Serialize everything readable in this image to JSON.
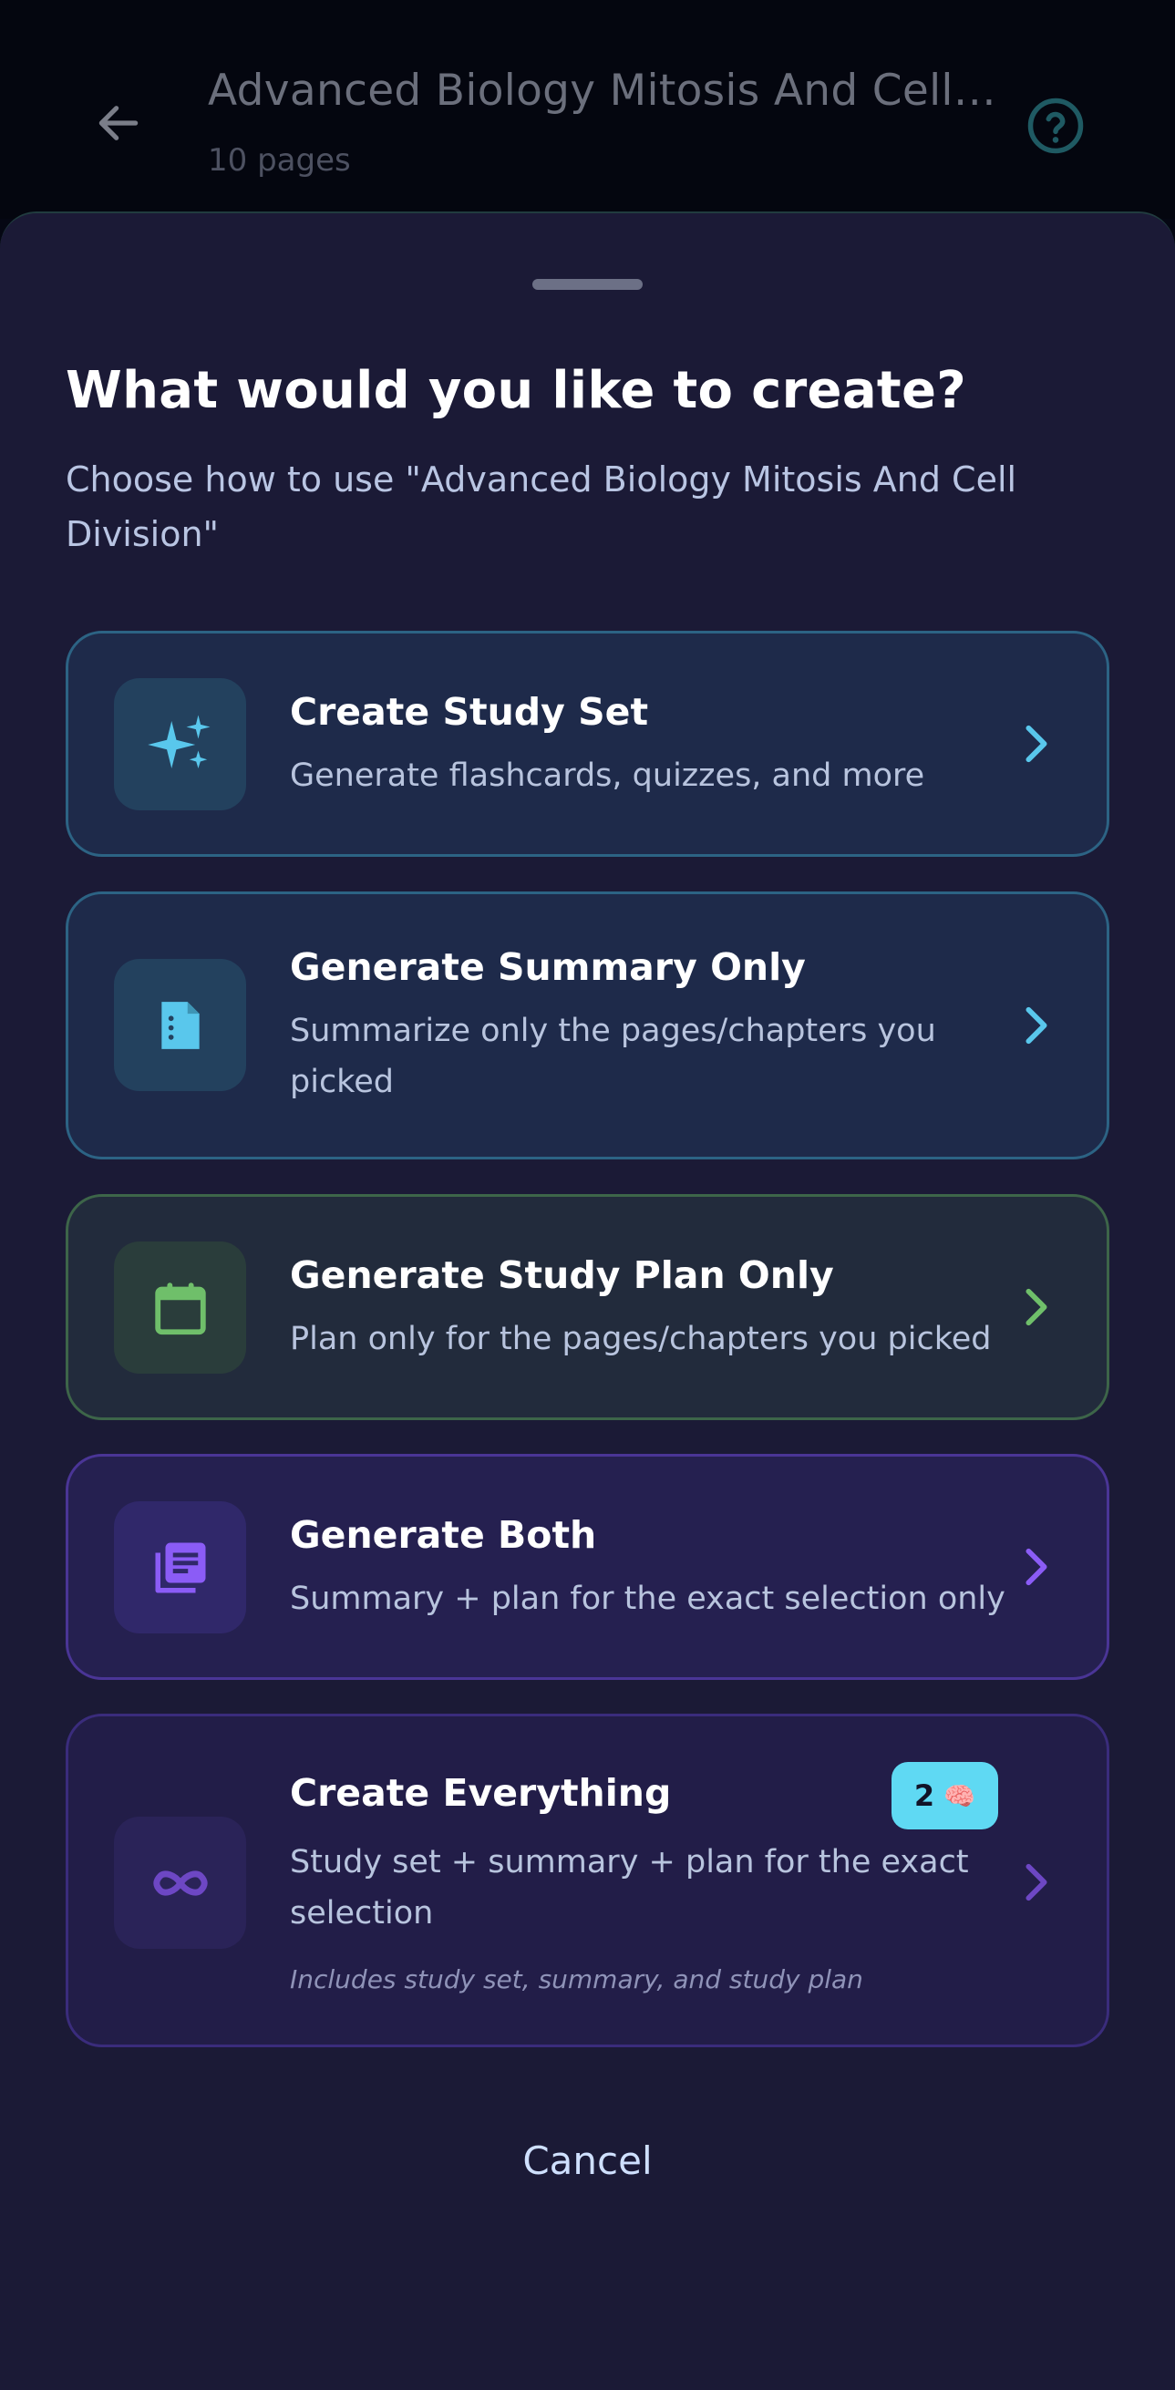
{
  "header": {
    "title": "Advanced Biology Mitosis And Cell Division",
    "subtitle": "10 pages",
    "back_icon": "arrow-left-icon",
    "help_icon": "question-circle-icon"
  },
  "sheet": {
    "title": "What would you like to create?",
    "subtitle": "Choose how to use \"Advanced Biology Mitosis And Cell Division\"",
    "options": [
      {
        "title": "Create Study Set",
        "desc": "Generate flashcards, quizzes, and more",
        "icon": "sparkles-icon",
        "accent": "#59c7ec"
      },
      {
        "title": "Generate Summary Only",
        "desc": "Summarize only the pages/chapters you picked",
        "icon": "document-icon",
        "accent": "#59c7ec"
      },
      {
        "title": "Generate Study Plan Only",
        "desc": "Plan only for the pages/chapters you picked",
        "icon": "calendar-icon",
        "accent": "#6fbf6a"
      },
      {
        "title": "Generate Both",
        "desc": "Summary + plan for the exact selection only",
        "icon": "stacked-docs-icon",
        "accent": "#8b5cf6"
      },
      {
        "title": "Create Everything",
        "desc": "Study set + summary + plan for the exact selection",
        "note": "Includes study set, summary, and study plan",
        "icon": "infinity-icon",
        "accent": "#6d47c4",
        "badge": {
          "count": "2",
          "emoji": "🧠"
        }
      }
    ],
    "cancel_label": "Cancel"
  }
}
